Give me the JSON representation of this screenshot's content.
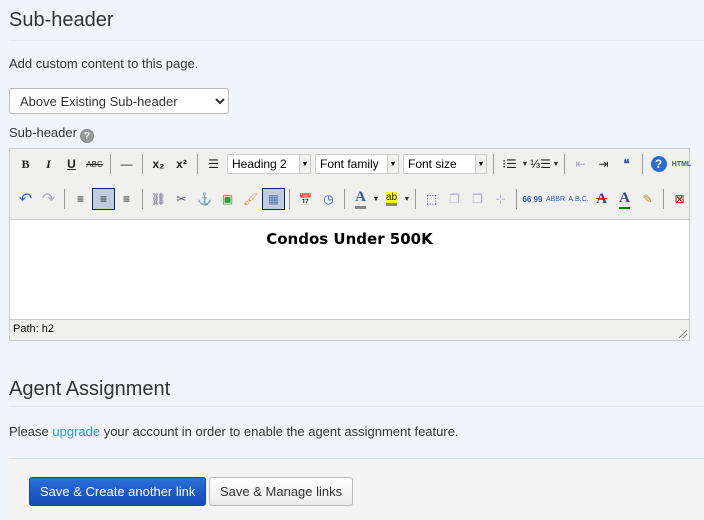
{
  "subheader": {
    "title": "Sub-header",
    "description": "Add custom content to this page.",
    "position_select": "Above Existing Sub-header",
    "label": "Sub-header",
    "help_glyph": "?"
  },
  "editor": {
    "row1": [
      {
        "name": "bold-icon",
        "glyph": "B",
        "style": "font-weight:bold;font-family:serif"
      },
      {
        "name": "italic-icon",
        "glyph": "I",
        "style": "font-style:italic;font-weight:bold;font-family:serif"
      },
      {
        "name": "underline-icon",
        "glyph": "U",
        "style": "text-decoration:underline;font-weight:bold"
      },
      {
        "name": "strikethrough-icon",
        "glyph": "ABC",
        "style": "font-size:8px;text-decoration:line-through"
      },
      {
        "sep": true
      },
      {
        "name": "horizontal-rule-icon",
        "glyph": "—"
      },
      {
        "sep": true
      },
      {
        "name": "subscript-icon",
        "glyph": "x₂",
        "style": "font-weight:bold"
      },
      {
        "name": "superscript-icon",
        "glyph": "x²",
        "style": "font-weight:bold"
      },
      {
        "sep": true
      },
      {
        "name": "justify-full-icon",
        "glyph": "☰"
      },
      {
        "select": true,
        "name": "format-select",
        "value": "Heading 2",
        "width": 84
      },
      {
        "select": true,
        "name": "font-family-select",
        "value": "Font family",
        "width": 84
      },
      {
        "select": true,
        "name": "font-size-select",
        "value": "Font size",
        "width": 84
      },
      {
        "sep": true
      },
      {
        "name": "bullet-list-icon",
        "glyph": "⁝☰",
        "arrow": true
      },
      {
        "name": "numbered-list-icon",
        "glyph": "⅓☰",
        "arrow": true
      },
      {
        "sep": true
      },
      {
        "name": "outdent-icon",
        "glyph": "⇤",
        "disabled": true
      },
      {
        "name": "indent-icon",
        "glyph": "⇥"
      },
      {
        "name": "blockquote-icon",
        "glyph": "❝",
        "style": "color:#3b5fa8;font-weight:bold"
      },
      {
        "sep": true
      },
      {
        "name": "help-icon",
        "glyph": "?",
        "style": "color:#fff;background:#2e6bd1;border-radius:50%;width:16px;height:16px;font-weight:bold"
      },
      {
        "name": "html-source-icon",
        "glyph": "HTML",
        "style": "font-size:7px;font-weight:bold;color:#2e5aa8"
      }
    ],
    "row2": [
      {
        "name": "undo-icon",
        "glyph": "↶",
        "style": "color:#2e6bd1;font-size:16px"
      },
      {
        "name": "redo-icon",
        "glyph": "↷",
        "disabled": true,
        "style": "font-size:16px"
      },
      {
        "sep": true
      },
      {
        "name": "align-left-icon",
        "glyph": "≡"
      },
      {
        "name": "align-center-icon",
        "glyph": "≡",
        "active": true
      },
      {
        "name": "align-right-icon",
        "glyph": "≡"
      },
      {
        "sep": true
      },
      {
        "name": "link-icon",
        "glyph": "⛓",
        "style": "color:#557"
      },
      {
        "name": "unlink-icon",
        "glyph": "✂",
        "style": "color:#557"
      },
      {
        "name": "anchor-icon",
        "glyph": "⚓",
        "style": "color:#2a4a88"
      },
      {
        "name": "image-icon",
        "glyph": "▣",
        "style": "color:#3a9a3a"
      },
      {
        "name": "cleanup-icon",
        "glyph": "🖌",
        "style": "color:#c9a040"
      },
      {
        "name": "table-icon",
        "glyph": "▦",
        "active": true,
        "style": "color:#5577aa"
      },
      {
        "sep": true
      },
      {
        "name": "insert-date-icon",
        "glyph": "📅",
        "style": "font-size:11px"
      },
      {
        "name": "insert-time-icon",
        "glyph": "◷",
        "style": "color:#2e5aa8"
      },
      {
        "sep": true
      },
      {
        "name": "text-color-icon",
        "glyph": "A",
        "arrow": true,
        "style": "color:#2e5aa8;font-weight:bold;font-family:serif;font-size:15px;border-bottom:3px solid #888"
      },
      {
        "name": "background-color-icon",
        "glyph": "ab",
        "arrow": true,
        "style": "background:#ff0;font-size:10px;border-bottom:3px solid #888"
      },
      {
        "sep": true
      },
      {
        "name": "insert-layer-icon",
        "glyph": "⬚",
        "style": "color:#2e4a88"
      },
      {
        "name": "move-forward-icon",
        "glyph": "❐",
        "disabled": true
      },
      {
        "name": "move-backward-icon",
        "glyph": "❐",
        "disabled": true
      },
      {
        "name": "absolute-position-icon",
        "glyph": "⊹",
        "disabled": true
      },
      {
        "sep": true
      },
      {
        "name": "cite-icon",
        "glyph": "66 99",
        "style": "font-size:8px;font-weight:bold;color:#2e5aa8"
      },
      {
        "name": "abbreviation-icon",
        "glyph": "ABBR",
        "style": "font-size:7px;color:#2e5aa8"
      },
      {
        "name": "acronym-icon",
        "glyph": "A.B.C.",
        "style": "font-size:7px;color:#2e5aa8"
      },
      {
        "name": "deletion-icon",
        "glyph": "A",
        "style": "text-decoration:line-through;text-decoration-color:red;color:#2e4a88;font-family:serif;font-weight:bold;font-size:15px"
      },
      {
        "name": "insertion-icon",
        "glyph": "A",
        "style": "border-bottom:2px solid green;color:#2e4a88;font-family:serif;font-weight:bold;font-size:15px"
      },
      {
        "name": "attributes-icon",
        "glyph": "✎",
        "style": "color:#b89030"
      },
      {
        "sep": true
      },
      {
        "name": "visual-chars-icon",
        "glyph": "⊠",
        "style": "color:#c00"
      }
    ],
    "content_heading": "Condos Under 500K",
    "path": "Path: h2"
  },
  "agent": {
    "title": "Agent Assignment",
    "text_before": "Please ",
    "link": "upgrade",
    "text_after": " your account in order to enable the agent assignment feature."
  },
  "footer": {
    "primary": "Save & Create another link",
    "secondary": "Save & Manage links"
  },
  "colors": {
    "primary": "#1b56c4",
    "link": "#2a9fd6",
    "background": "#f1f4f9"
  }
}
